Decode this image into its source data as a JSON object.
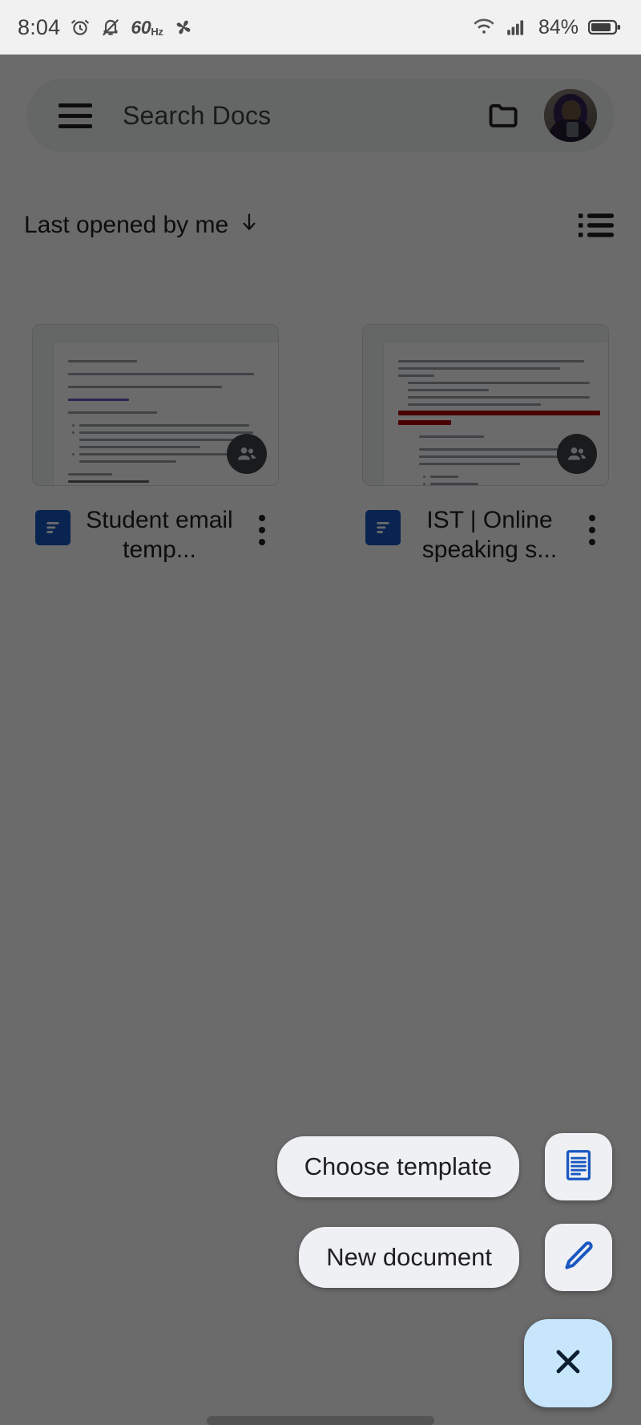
{
  "statusbar": {
    "time": "8:04",
    "alarm_icon": "alarm-icon",
    "mute_icon": "bell-muted-icon",
    "refresh_rate": "60",
    "refresh_rate_unit": "Hz",
    "fan_icon": "fan-icon",
    "wifi_icon": "wifi-icon",
    "signal_icon": "cellular-signal-icon",
    "battery_percent": "84%",
    "battery_icon": "battery-icon",
    "bg": "#f1f1f1"
  },
  "appbar": {
    "menu_icon": "hamburger-menu-icon",
    "search_placeholder": "Search Docs",
    "folder_icon": "folder-icon",
    "avatar_label": "account-avatar"
  },
  "toolbar": {
    "sort_label": "Last opened by me",
    "sort_arrow_icon": "arrow-down-icon",
    "list_view_icon": "list-view-icon"
  },
  "documents": [
    {
      "title": "Student email temp...",
      "type_icon": "google-docs-icon",
      "shared_icon": "shared-people-icon",
      "menu_icon": "more-options-icon"
    },
    {
      "title": "IST | Online speaking s...",
      "type_icon": "google-docs-icon",
      "shared_icon": "shared-people-icon",
      "menu_icon": "more-options-icon"
    }
  ],
  "fab_menu": {
    "choose_template_label": "Choose template",
    "choose_template_icon": "document-template-icon",
    "new_document_label": "New document",
    "new_document_icon": "pencil-edit-icon",
    "close_icon": "close-x-icon",
    "close_fab_color": "#c7e6fb",
    "accent_blue": "#1a57c1"
  },
  "system": {
    "gesture_bar": "gesture-navigation-bar"
  }
}
